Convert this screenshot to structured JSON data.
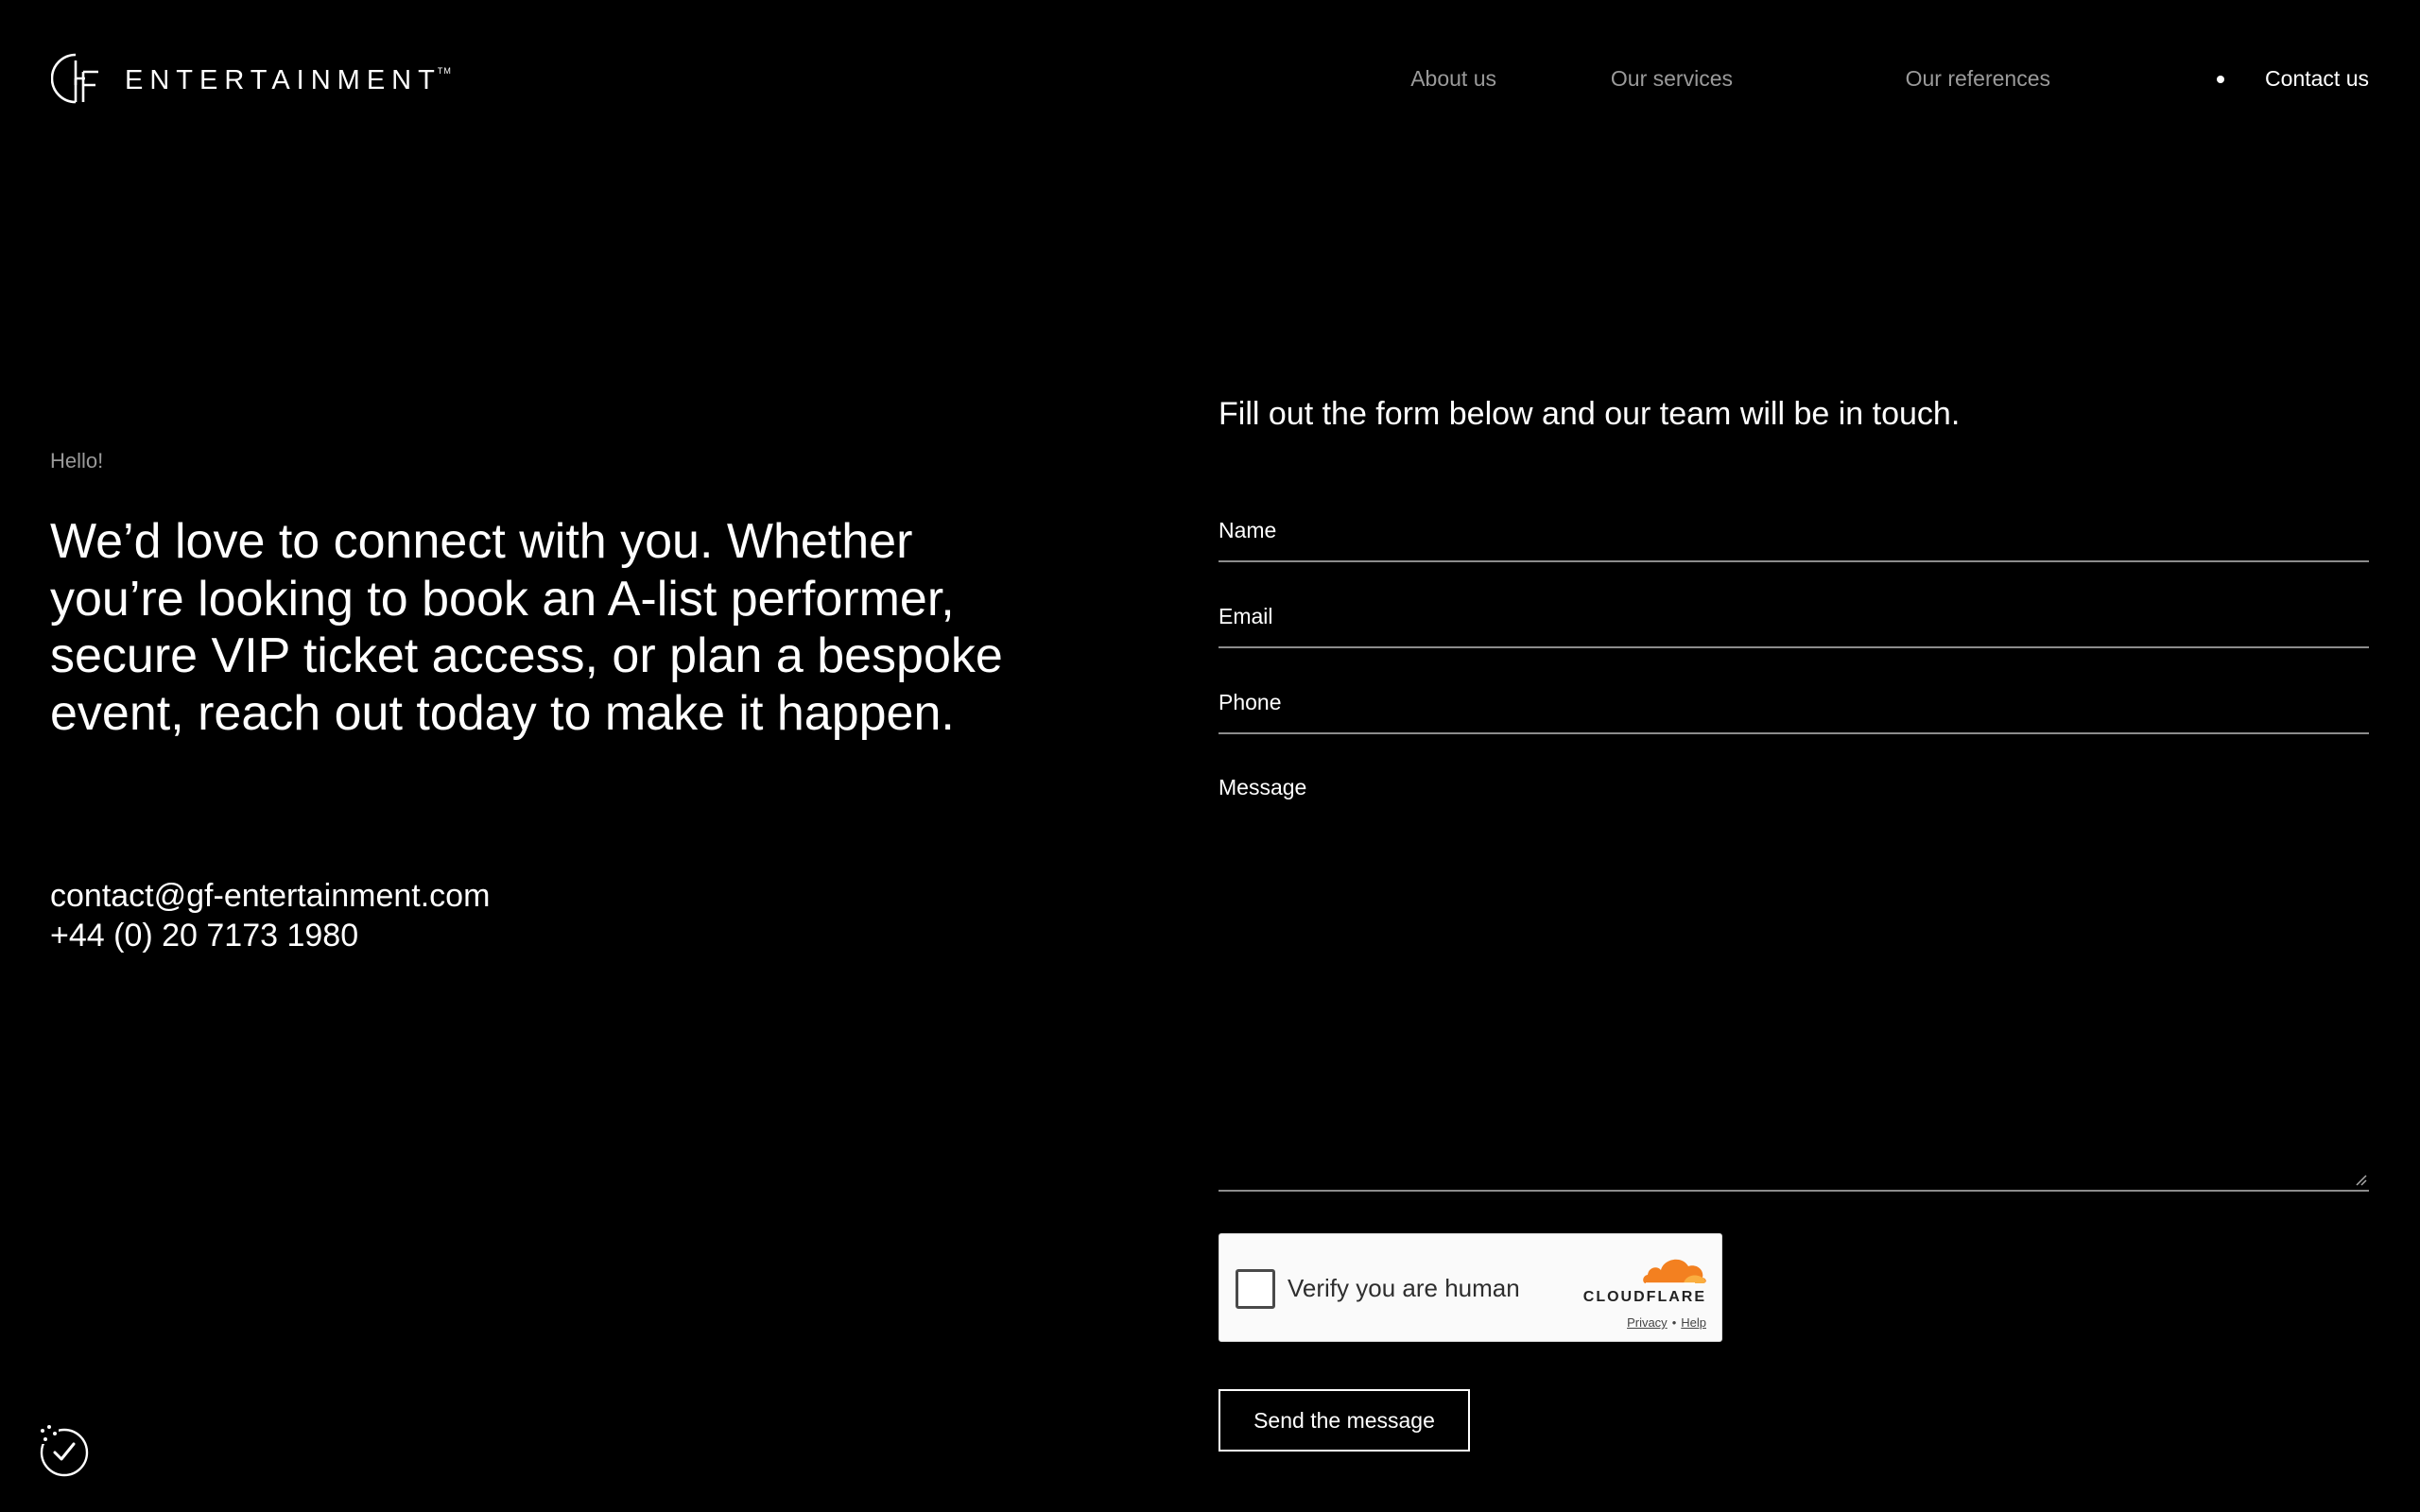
{
  "brand": {
    "name": "ENTERTAINMENT",
    "trademark": "TM",
    "logo_icon": "gf-monogram-icon"
  },
  "nav": {
    "items": [
      {
        "label": "About us"
      },
      {
        "label": "Our services"
      },
      {
        "label": "Our references"
      },
      {
        "label": "Contact us",
        "active": true
      }
    ]
  },
  "intro": {
    "eyebrow": "Hello!",
    "text": "We’d love to connect with you. Whether you’re looking to book an A-list performer, secure VIP ticket access, or plan a bespoke event, reach out today to make it happen."
  },
  "contact": {
    "email": "contact@gf-entertainment.com",
    "phone": "+44 (0) 20 7173 1980"
  },
  "form": {
    "lead": "Fill out the form below and our team will be in touch.",
    "fields": {
      "name": {
        "label": "Name",
        "value": ""
      },
      "email": {
        "label": "Email",
        "value": ""
      },
      "phone": {
        "label": "Phone",
        "value": ""
      },
      "message": {
        "label": "Message",
        "value": ""
      }
    },
    "captcha": {
      "label": "Verify you are human",
      "checked": false,
      "provider": "CLOUDFLARE",
      "privacy": "Privacy",
      "separator": "•",
      "help": "Help"
    },
    "submit_label": "Send the message"
  },
  "colors": {
    "background": "#000000",
    "text": "#ffffff",
    "muted": "#9a9a9a",
    "cloudflare_orange": "#f38020"
  },
  "icons": {
    "consent": "cookie-consent-icon"
  }
}
